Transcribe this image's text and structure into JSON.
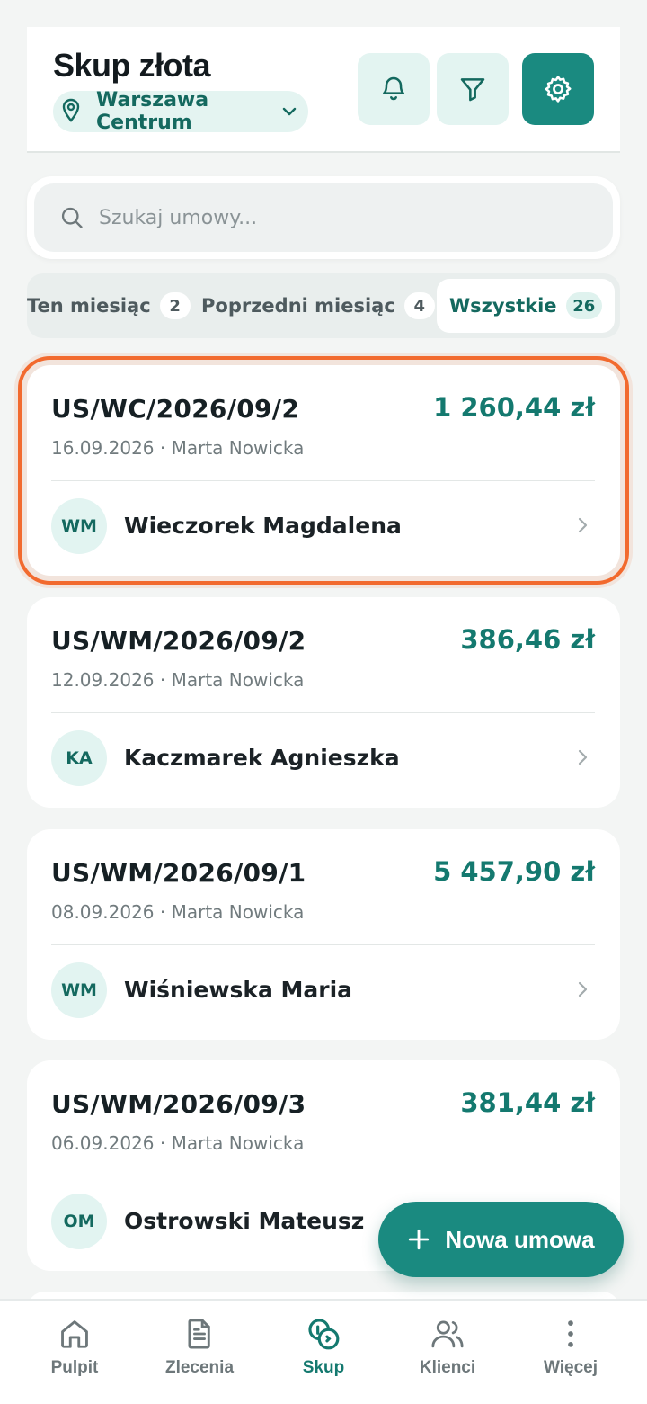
{
  "header": {
    "title": "Skup złota",
    "branch": "Warszawa Centrum",
    "icons": [
      "bell-icon",
      "filter-icon",
      "gear-icon"
    ]
  },
  "search": {
    "placeholder": "Szukaj umowy..."
  },
  "tabs": [
    {
      "label": "Ten miesiąc",
      "count": "2"
    },
    {
      "label": "Poprzedni miesiąc",
      "count": "4"
    },
    {
      "label": "Wszystkie",
      "count": "26",
      "active": true
    }
  ],
  "contracts": [
    {
      "number": "US/WC/2026/09/2",
      "amount": "1 260,44 zł",
      "meta": "16.09.2026 · Marta Nowicka",
      "initials": "WM",
      "client": "Wieczorek Magdalena",
      "selected": true
    },
    {
      "number": "US/WM/2026/09/2",
      "amount": "386,46 zł",
      "meta": "12.09.2026 · Marta Nowicka",
      "initials": "KA",
      "client": "Kaczmarek Agnieszka"
    },
    {
      "number": "US/WM/2026/09/1",
      "amount": "5 457,90 zł",
      "meta": "08.09.2026 · Marta Nowicka",
      "initials": "WM",
      "client": "Wiśniewska Maria"
    },
    {
      "number": "US/WM/2026/09/3",
      "amount": "381,44 zł",
      "meta": "06.09.2026 · Marta Nowicka",
      "initials": "OM",
      "client": "Ostrowski Mateusz"
    }
  ],
  "fab": {
    "label": "Nowa umowa"
  },
  "nav": [
    {
      "label": "Pulpit",
      "icon": "home-icon"
    },
    {
      "label": "Zlecenia",
      "icon": "document-icon"
    },
    {
      "label": "Skup",
      "icon": "coins-icon",
      "active": true
    },
    {
      "label": "Klienci",
      "icon": "users-icon"
    },
    {
      "label": "Więcej",
      "icon": "more-vertical-icon"
    }
  ],
  "colors": {
    "accent": "#1a8a80",
    "accent_text": "#14796f",
    "selection": "#f26a2e",
    "background": "#f3f5f4"
  }
}
